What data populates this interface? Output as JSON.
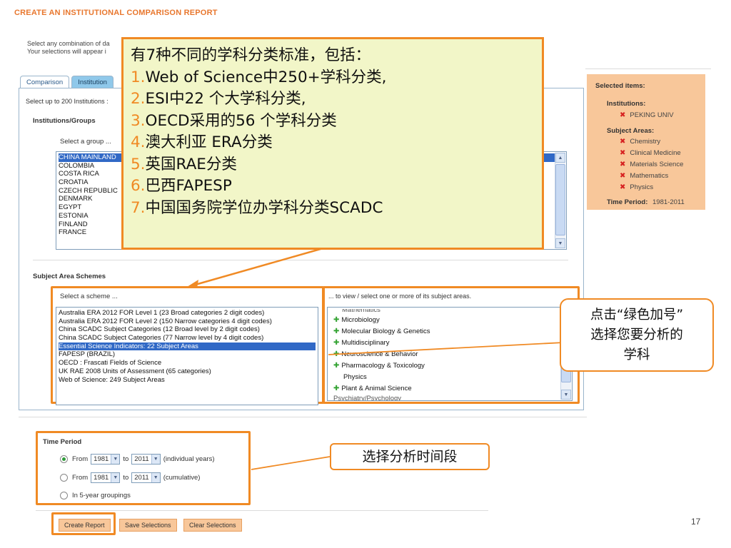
{
  "page_title": "CREATE AN INSTITUTIONAL COMPARISON REPORT",
  "intro": {
    "line1": "Select any combination of da",
    "line2": "Your selections will appear i"
  },
  "tabs": [
    {
      "label": "Comparison",
      "active": true
    },
    {
      "label": "Institution",
      "active": false
    }
  ],
  "select_hint": "Select up to 200 Institutions :",
  "institutions": {
    "heading": "Institutions/Groups",
    "group_label": "Select a group ...",
    "list": [
      "CHINA MAINLAND",
      "COLOMBIA",
      "COSTA RICA",
      "CROATIA",
      "CZECH REPUBLIC",
      "DENMARK",
      "EGYPT",
      "ESTONIA",
      "FINLAND",
      "FRANCE"
    ],
    "selected_index": 0
  },
  "subject_schemes": {
    "heading": "Subject Area Schemes",
    "scheme_label": "Select a scheme ...",
    "list": [
      "Australia ERA 2012 FOR Level 1 (23 Broad categories 2 digit codes)",
      "Australia ERA 2012 FOR Level 2 (150 Narrow categories 4 digit codes)",
      "China SCADC Subject Categories (12 Broad level by 2 digit codes)",
      "China SCADC Subject Categories (77 Narrow level by 4 digit codes)",
      "Essential Science Indicators: 22 Subject Areas",
      "FAPESP (BRAZIL)",
      "OECD : Frascati Fields of Science",
      "UK RAE 2008 Units of Assessment (65 categories)",
      "Web of Science: 249 Subject Areas"
    ],
    "selected_index": 4
  },
  "subject_areas": {
    "label": "... to view / select one or more of its subject areas.",
    "cut_top": "Mathematics",
    "items": [
      {
        "text": "Microbiology",
        "plus": true
      },
      {
        "text": "Molecular Biology & Genetics",
        "plus": true
      },
      {
        "text": "Multidisciplinary",
        "plus": true
      },
      {
        "text": "Neuroscience & Behavior",
        "plus": true
      },
      {
        "text": "Pharmacology & Toxicology",
        "plus": true
      },
      {
        "text": "Physics",
        "plus": false
      },
      {
        "text": "Plant & Animal Science",
        "plus": true
      }
    ],
    "cut_bottom": "Psychiatry/Psychology"
  },
  "selected_items": {
    "title": "Selected items:",
    "institutions_label": "Institutions:",
    "institutions": [
      "PEKING UNIV"
    ],
    "subject_areas_label": "Subject Areas:",
    "subject_areas": [
      "Chemistry",
      "Clinical Medicine",
      "Materials Science",
      "Mathematics",
      "Physics"
    ],
    "time_period_label": "Time Period:",
    "time_period_value": "1981-2011"
  },
  "time_period": {
    "heading": "Time Period",
    "from_label": "From",
    "to_label": "to",
    "from_value": "1981",
    "to_value": "2011",
    "individual_label": "(individual years)",
    "cumulative_label": "(cumulative)",
    "groupings_label": "In 5-year groupings",
    "selected_option": 0
  },
  "buttons": {
    "create": "Create Report",
    "save": "Save Selections",
    "clear": "Clear Selections"
  },
  "callout": {
    "intro": "有7种不同的学科分类标准，包括：",
    "items": [
      {
        "num": "1.",
        "text": "Web of Science中250+学科分类,"
      },
      {
        "num": "2.",
        "text": "ESI中22 个大学科分类,"
      },
      {
        "num": "3.",
        "text": "OECD采用的56 个学科分类"
      },
      {
        "num": "4.",
        "text": "澳大利亚 ERA分类"
      },
      {
        "num": "5.",
        "text": "英国RAE分类"
      },
      {
        "num": "6.",
        "text": "巴西FAPESP"
      },
      {
        "num": "7.",
        "text": "中国国务院学位办学科分类SCADC"
      }
    ]
  },
  "bubble_subject": {
    "line1": "点击“绿色加号”",
    "line2": "选择您要分析的",
    "line3": "学科"
  },
  "bubble_time": "选择分析时间段",
  "page_number": "17",
  "colors": {
    "accent_orange": "#f08a24",
    "callout_bg": "#f2f6c8",
    "selected_panel_bg": "#f8c79a",
    "list_selection": "#3169c6",
    "tab_inactive": "#8fc8ea"
  }
}
